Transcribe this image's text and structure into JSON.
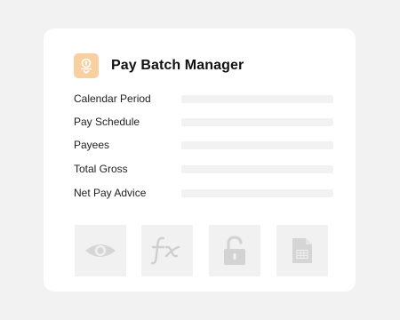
{
  "app": {
    "title": "Pay Batch Manager",
    "icon": "money-download-icon",
    "accent_color": "#f8cf9f"
  },
  "fields": [
    {
      "label": "Calendar Period",
      "value": ""
    },
    {
      "label": "Pay Schedule",
      "value": ""
    },
    {
      "label": "Payees",
      "value": ""
    },
    {
      "label": "Total Gross",
      "value": ""
    },
    {
      "label": "Net Pay Advice",
      "value": ""
    }
  ],
  "toolbar": [
    {
      "icon": "eye-icon"
    },
    {
      "icon": "fx-icon"
    },
    {
      "icon": "unlocked-padlock-icon"
    },
    {
      "icon": "spreadsheet-document-icon"
    }
  ]
}
